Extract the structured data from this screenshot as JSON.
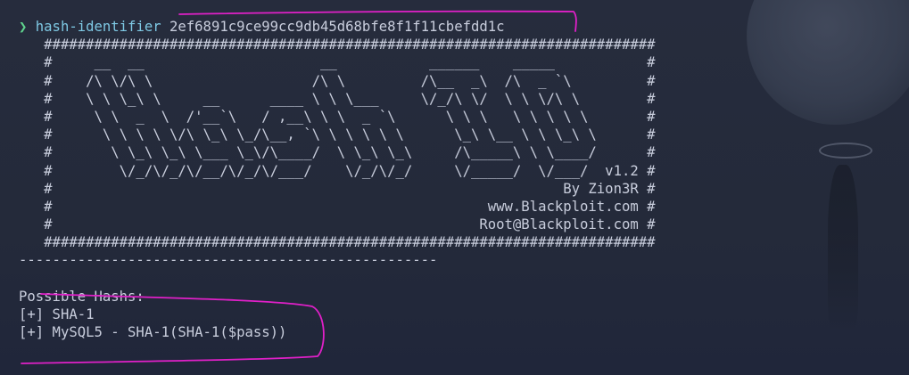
{
  "prompt": {
    "arrow": "❯",
    "command": "hash-identifier",
    "argument": "2ef6891c9ce99cc9db45d68bfe8f1f11cbefdd1c"
  },
  "banner_lines": [
    "   #########################################################################",
    "   #     __  __                     __           ______    _____           #",
    "   #    /\\ \\/\\ \\                   /\\ \\         /\\__  _\\  /\\  _ `\\         #",
    "   #    \\ \\ \\_\\ \\     __      ____ \\ \\ \\___     \\/_/\\ \\/  \\ \\ \\/\\ \\        #",
    "   #     \\ \\  _  \\  /'__`\\   / ,__\\ \\ \\  _ `\\      \\ \\ \\   \\ \\ \\ \\ \\       #",
    "   #      \\ \\ \\ \\ \\/\\ \\_\\ \\_/\\__, `\\ \\ \\ \\ \\ \\      \\_\\ \\__ \\ \\ \\_\\ \\      #",
    "   #       \\ \\_\\ \\_\\ \\___ \\_\\/\\____/  \\ \\_\\ \\_\\     /\\_____\\ \\ \\____/      #",
    "   #        \\/_/\\/_/\\/__/\\/_/\\/___/    \\/_/\\/_/     \\/_____/  \\/___/  v1.2 #",
    "   #                                                             By Zion3R #",
    "   #                                                    www.Blackploit.com #",
    "   #                                                   Root@Blackploit.com #",
    "   #########################################################################"
  ],
  "separator": "--------------------------------------------------",
  "result": {
    "heading": "Possible Hashs:",
    "items": [
      "[+] SHA-1",
      "[+] MySQL5 - SHA-1(SHA-1($pass))"
    ]
  },
  "colors": {
    "background": "#252b3c",
    "prompt_arrow": "#5fd38d",
    "command": "#7ec8e3",
    "text": "#c8cddc",
    "annotation": "#e020c8"
  }
}
